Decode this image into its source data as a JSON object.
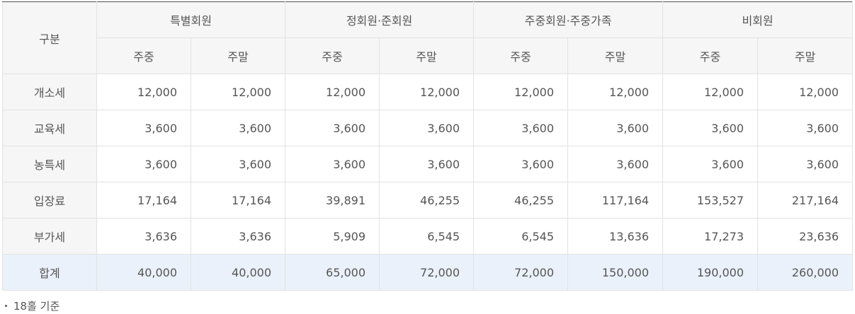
{
  "table": {
    "category_header": "구분",
    "groups": [
      "특별회원",
      "정회원·준회원",
      "주중회원·주중가족",
      "비회원"
    ],
    "subheaders": [
      "주중",
      "주말",
      "주중",
      "주말",
      "주중",
      "주말",
      "주중",
      "주말"
    ],
    "rows": [
      {
        "label": "개소세",
        "values": [
          "12,000",
          "12,000",
          "12,000",
          "12,000",
          "12,000",
          "12,000",
          "12,000",
          "12,000"
        ]
      },
      {
        "label": "교육세",
        "values": [
          "3,600",
          "3,600",
          "3,600",
          "3,600",
          "3,600",
          "3,600",
          "3,600",
          "3,600"
        ]
      },
      {
        "label": "농특세",
        "values": [
          "3,600",
          "3,600",
          "3,600",
          "3,600",
          "3,600",
          "3,600",
          "3,600",
          "3,600"
        ]
      },
      {
        "label": "입장료",
        "values": [
          "17,164",
          "17,164",
          "39,891",
          "46,255",
          "46,255",
          "117,164",
          "153,527",
          "217,164"
        ]
      },
      {
        "label": "부가세",
        "values": [
          "3,636",
          "3,636",
          "5,909",
          "6,545",
          "6,545",
          "13,636",
          "17,273",
          "23,636"
        ]
      },
      {
        "label": "합계",
        "values": [
          "40,000",
          "40,000",
          "65,000",
          "72,000",
          "72,000",
          "150,000",
          "190,000",
          "260,000"
        ]
      }
    ]
  },
  "note": "18홀 기준",
  "colors": {
    "header_bg": "#f6f6f6",
    "total_row_bg": "#eaf1fb",
    "border": "#e2e2e2",
    "top_border": "#555555",
    "text": "#555555"
  }
}
